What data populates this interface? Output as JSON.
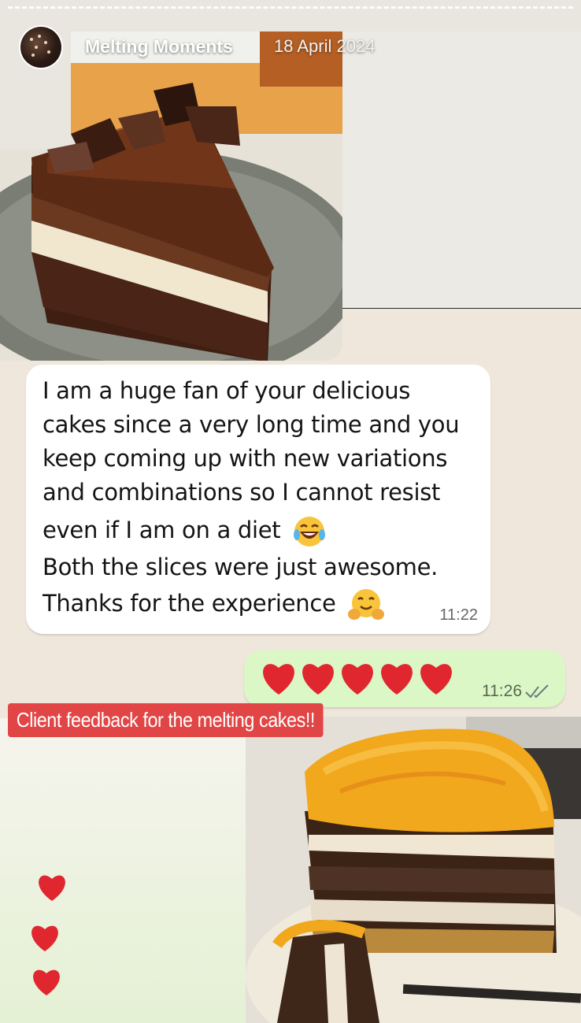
{
  "story": {
    "account_name": "Melting Moments",
    "post_date": "18 April 2024",
    "caption": "Client feedback for the melting cakes!!"
  },
  "chat": {
    "incoming": {
      "lines": [
        "I am a huge fan of your delicious",
        "cakes since a very long time and you",
        "keep coming up with new variations",
        "and combinations so I cannot resist",
        "even if I am on a diet",
        "Both the slices were just awesome.",
        "Thanks for the experience"
      ],
      "time": "11:22"
    },
    "outgoing": {
      "hearts_count": 5,
      "time": "11:26",
      "status_icon": "double-check-icon"
    }
  },
  "images": {
    "top": "chocolate-cake-slice",
    "bottom": "mango-layer-cake-slice"
  },
  "decorations": {
    "side_hearts_count": 3,
    "heart_color": "#e0262f"
  },
  "colors": {
    "caption_bg": "#e14545",
    "outgoing_bubble": "#dcf7c6",
    "incoming_bubble": "#ffffff"
  }
}
